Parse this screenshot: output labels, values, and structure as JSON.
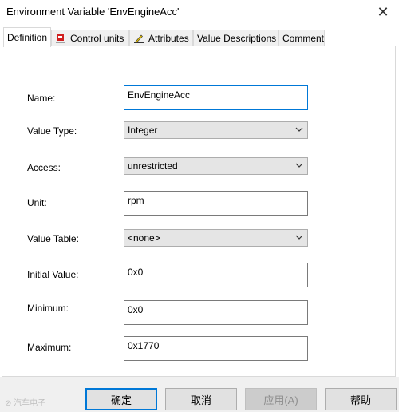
{
  "window": {
    "title": "Environment Variable 'EnvEngineAcc'",
    "close_glyph": "✕"
  },
  "tabs": [
    {
      "label": "Definition",
      "icon": ""
    },
    {
      "label": "Control units",
      "icon": "control-units-icon"
    },
    {
      "label": "Attributes",
      "icon": "attributes-icon"
    },
    {
      "label": "Value Descriptions",
      "icon": ""
    },
    {
      "label": "Comment",
      "icon": ""
    }
  ],
  "form": {
    "name": {
      "label": "Name:",
      "value": "EnvEngineAcc"
    },
    "value_type": {
      "label": "Value Type:",
      "value": "Integer"
    },
    "access": {
      "label": "Access:",
      "value": "unrestricted"
    },
    "unit": {
      "label": "Unit:",
      "value": "rpm"
    },
    "value_table": {
      "label": "Value Table:",
      "value": "<none>"
    },
    "initial_value": {
      "label": "Initial Value:",
      "value": "0x0"
    },
    "minimum": {
      "label": "Minimum:",
      "value": "0x0"
    },
    "maximum": {
      "label": "Maximum:",
      "value": "0x1770"
    }
  },
  "buttons": {
    "ok": "确定",
    "cancel": "取消",
    "apply": "应用(A)",
    "help": "帮助"
  },
  "watermark": "⊘ 汽车电子",
  "colors": {
    "focus": "#0078d7",
    "footer_bg": "#f0f0f0"
  }
}
